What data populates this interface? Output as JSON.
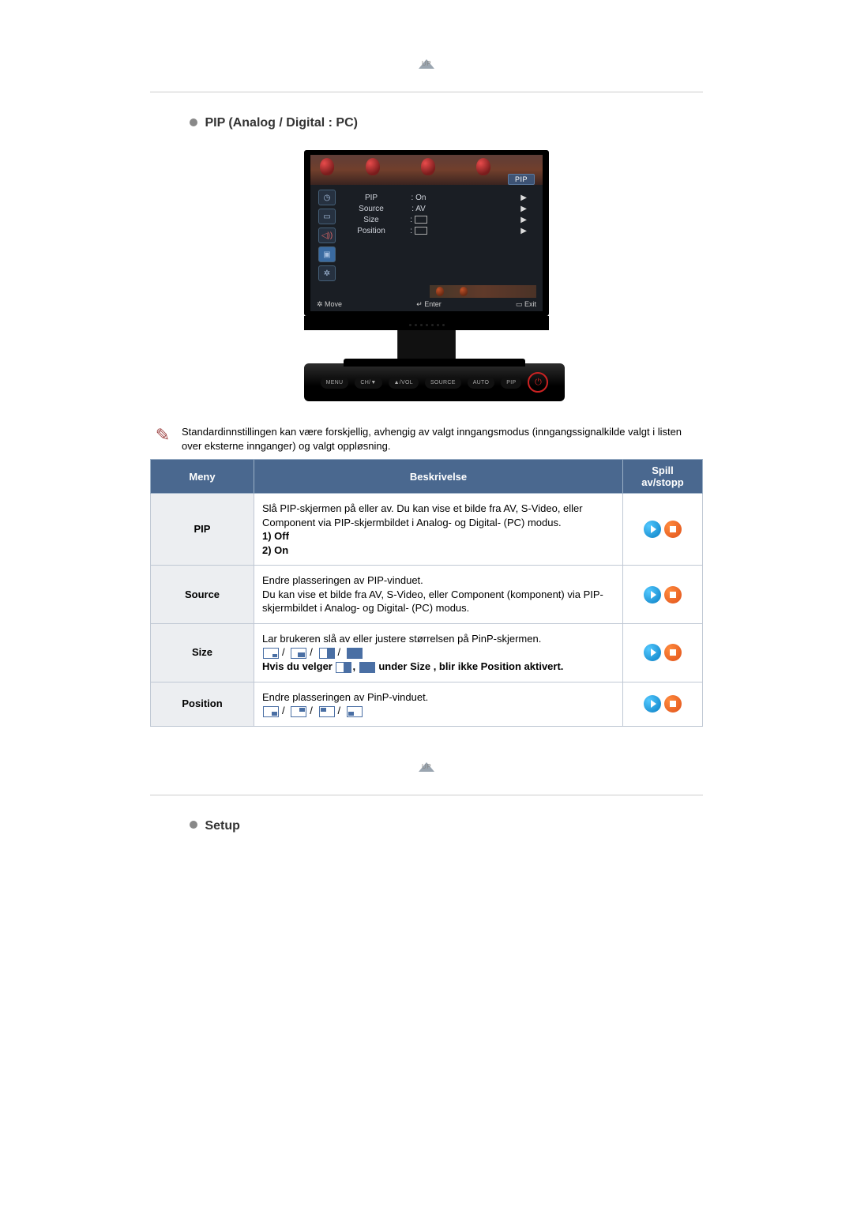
{
  "up_label": "UP",
  "section_pip_title": "PIP (Analog / Digital : PC)",
  "section_setup_title": "Setup",
  "osd": {
    "pip_badge": "PIP",
    "rows": [
      {
        "label": "PIP",
        "value": ": On"
      },
      {
        "label": "Source",
        "value": ": AV"
      },
      {
        "label": "Size",
        "value": ""
      },
      {
        "label": "Position",
        "value": ""
      }
    ],
    "footer_move": "Move",
    "footer_enter": "Enter",
    "footer_exit": "Exit"
  },
  "monitor_buttons": {
    "menu": "MENU",
    "ch": "CH/▼",
    "vol": "▲/VOL",
    "source": "SOURCE",
    "auto": "AUTO",
    "pip": "PIP",
    "power": "⏻"
  },
  "note_text": "Standardinnstillingen kan være forskjellig, avhengig av valgt inngangsmodus (inngangssignalkilde valgt i listen over eksterne innganger) og valgt oppløsning.",
  "table_headers": {
    "menu": "Meny",
    "desc": "Beskrivelse",
    "play": "Spill av/stopp"
  },
  "rows": {
    "pip": {
      "name": "PIP",
      "desc1": "Slå PIP-skjermen på eller av. Du kan vise et bilde fra AV, S-Video, eller Component via PIP-skjermbildet i Analog- og Digital- (PC) modus.",
      "opt1": "1) Off",
      "opt2": "2) On"
    },
    "source": {
      "name": "Source",
      "desc": "Endre plasseringen av PIP-vinduet.\nDu kan vise et bilde fra AV, S-Video, eller Component (komponent) via PIP-skjermbildet i Analog- og Digital- (PC) modus."
    },
    "size": {
      "name": "Size",
      "desc1": "Lar brukeren slå av eller justere størrelsen på PinP-skjermen.",
      "desc2a": "Hvis du velger ",
      "desc2b": " under Size , blir ikke Position aktivert."
    },
    "position": {
      "name": "Position",
      "desc": "Endre plasseringen av PinP-vinduet."
    }
  }
}
